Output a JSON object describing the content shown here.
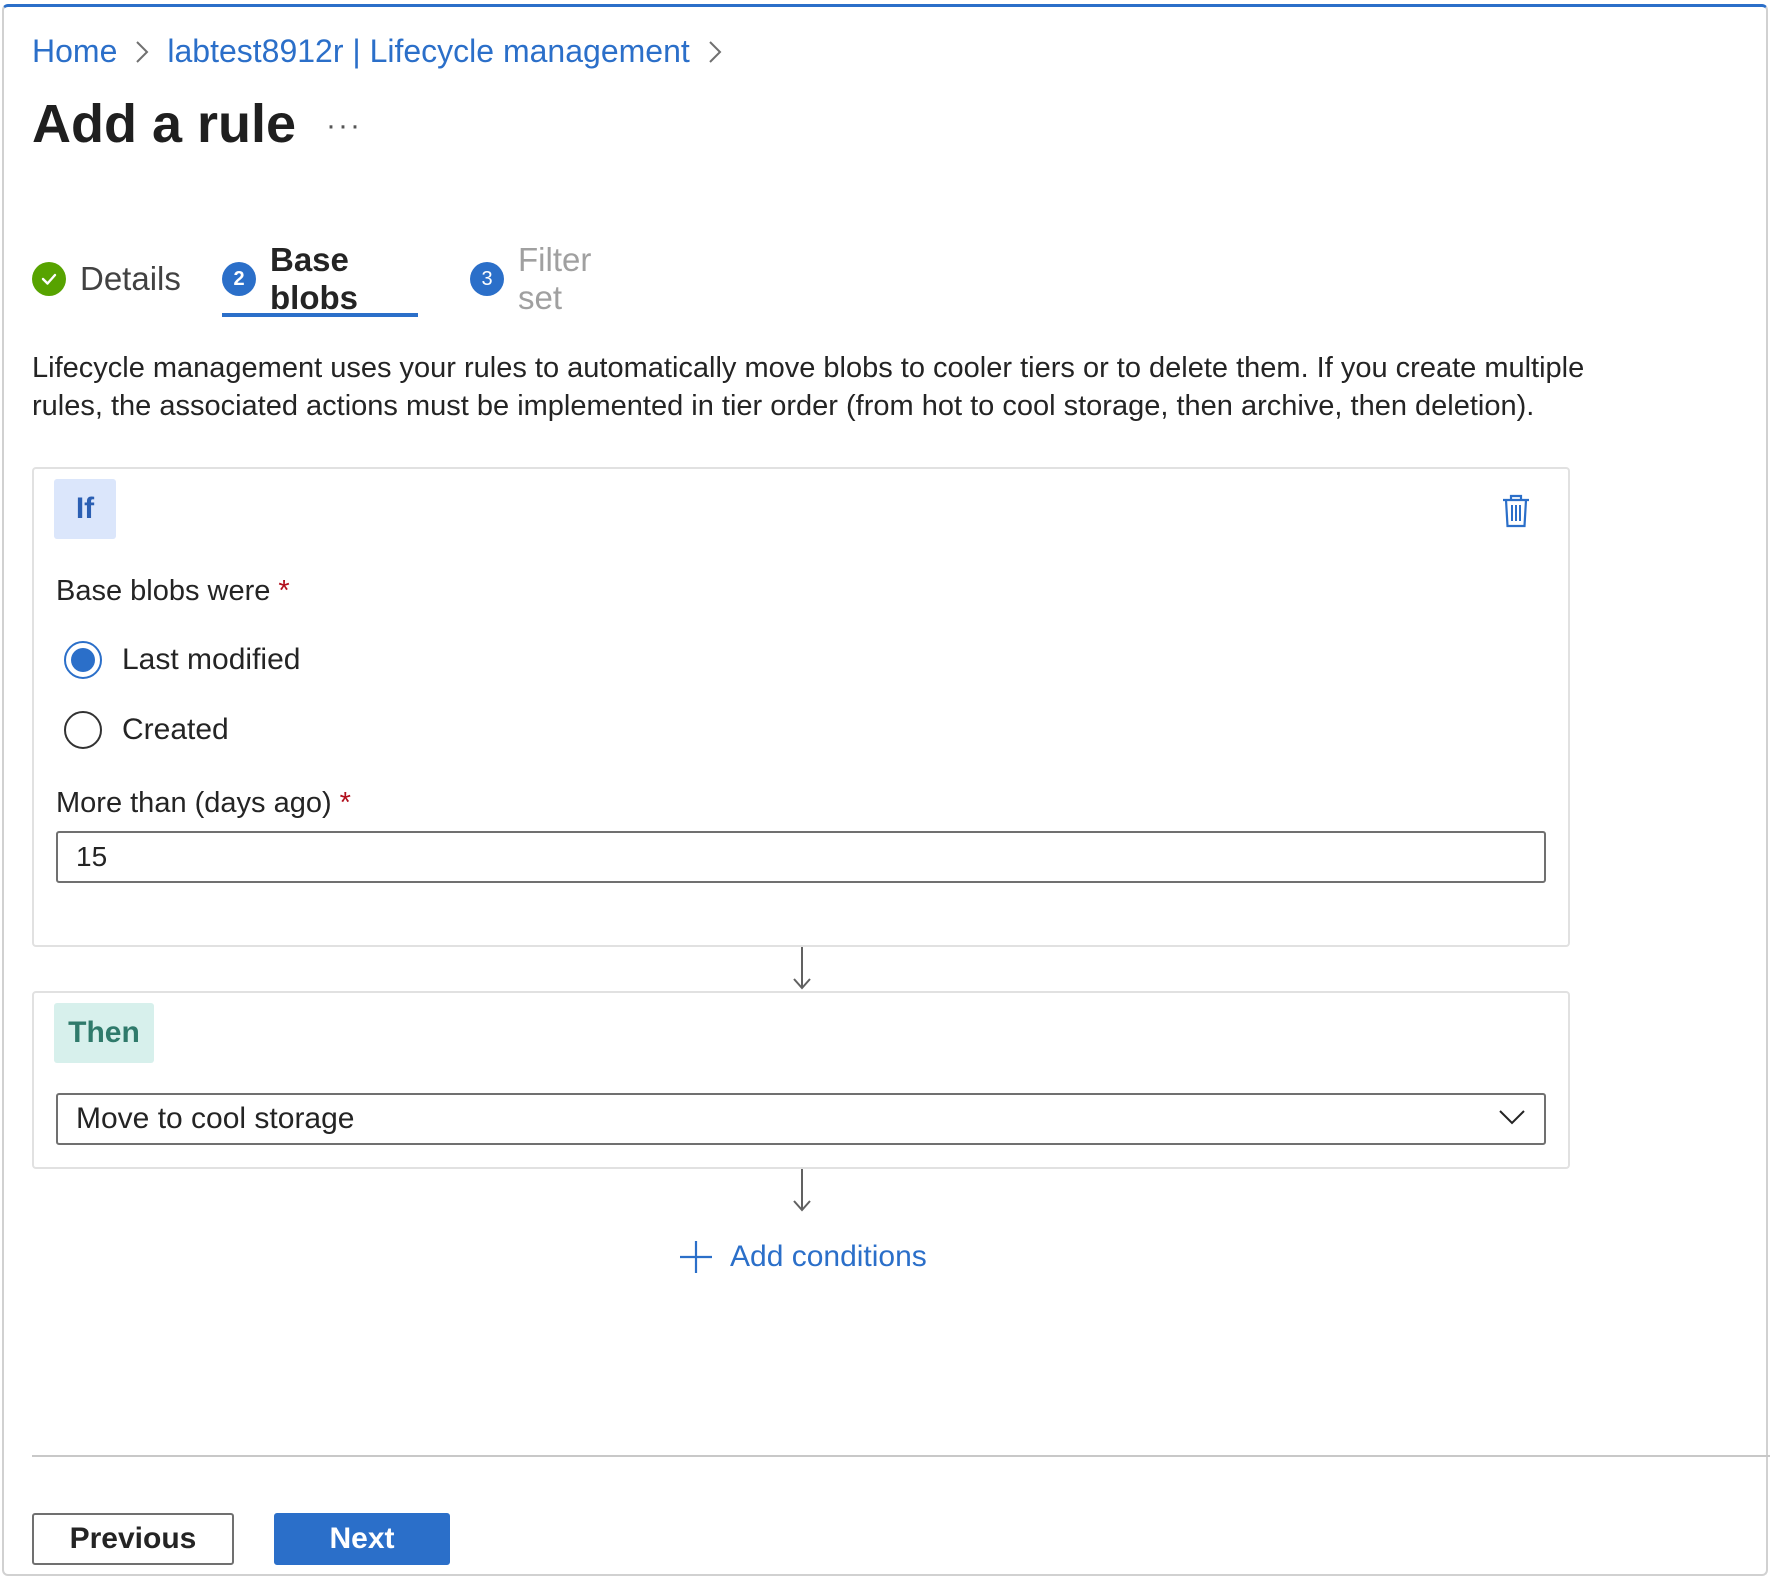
{
  "breadcrumb": {
    "home": "Home",
    "resource": "labtest8912r | Lifecycle management"
  },
  "page": {
    "title": "Add a rule",
    "more": "···"
  },
  "tabs": [
    {
      "label": "Details",
      "badge": "✓",
      "state": "completed"
    },
    {
      "label": "Base blobs",
      "badge": "2",
      "state": "active"
    },
    {
      "label": "Filter set",
      "badge": "3",
      "state": "disabled"
    }
  ],
  "description": "Lifecycle management uses your rules to automatically move blobs to cooler tiers or to delete them. If you create multiple rules, the associated actions must be implemented in tier order (from hot to cool storage, then archive, then deletion).",
  "if_block": {
    "tag": "If",
    "base_blobs_label": "Base blobs were",
    "required_mark": "*",
    "options": [
      {
        "label": "Last modified",
        "selected": true
      },
      {
        "label": "Created",
        "selected": false
      }
    ],
    "days_label": "More than (days ago)",
    "days_value": "15"
  },
  "then_block": {
    "tag": "Then",
    "action_value": "Move to cool storage"
  },
  "add_conditions": "Add conditions",
  "footer": {
    "previous": "Previous",
    "next": "Next"
  },
  "colors": {
    "accent": "#2b6fc9",
    "success": "#57a300",
    "if_tag_bg": "#dbe6fb",
    "then_tag_bg": "#d7f0ec",
    "required": "#b10e1c"
  }
}
